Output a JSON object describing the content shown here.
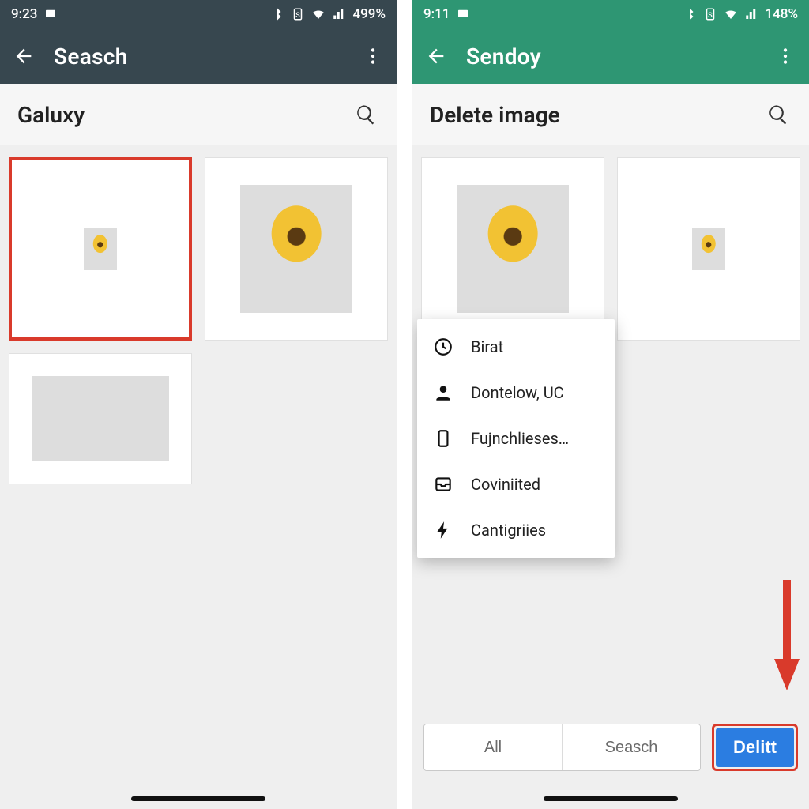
{
  "left": {
    "status": {
      "time": "9:23",
      "battery": "499%"
    },
    "appbar": {
      "title": "Seasch"
    },
    "subheader": {
      "title": "Galuxy"
    }
  },
  "right": {
    "status": {
      "time": "9:11",
      "battery": "148%"
    },
    "appbar": {
      "title": "Sendoy"
    },
    "subheader": {
      "title": "Delete image"
    },
    "menu": {
      "items": [
        {
          "label": "Birat"
        },
        {
          "label": "Dontelow, UC"
        },
        {
          "label": "Fujnchlieses…"
        },
        {
          "label": "Coviniited"
        },
        {
          "label": "Cantigriies"
        }
      ]
    },
    "buttons": {
      "all": "All",
      "search": "Seasch",
      "delete": "Delitt"
    }
  }
}
